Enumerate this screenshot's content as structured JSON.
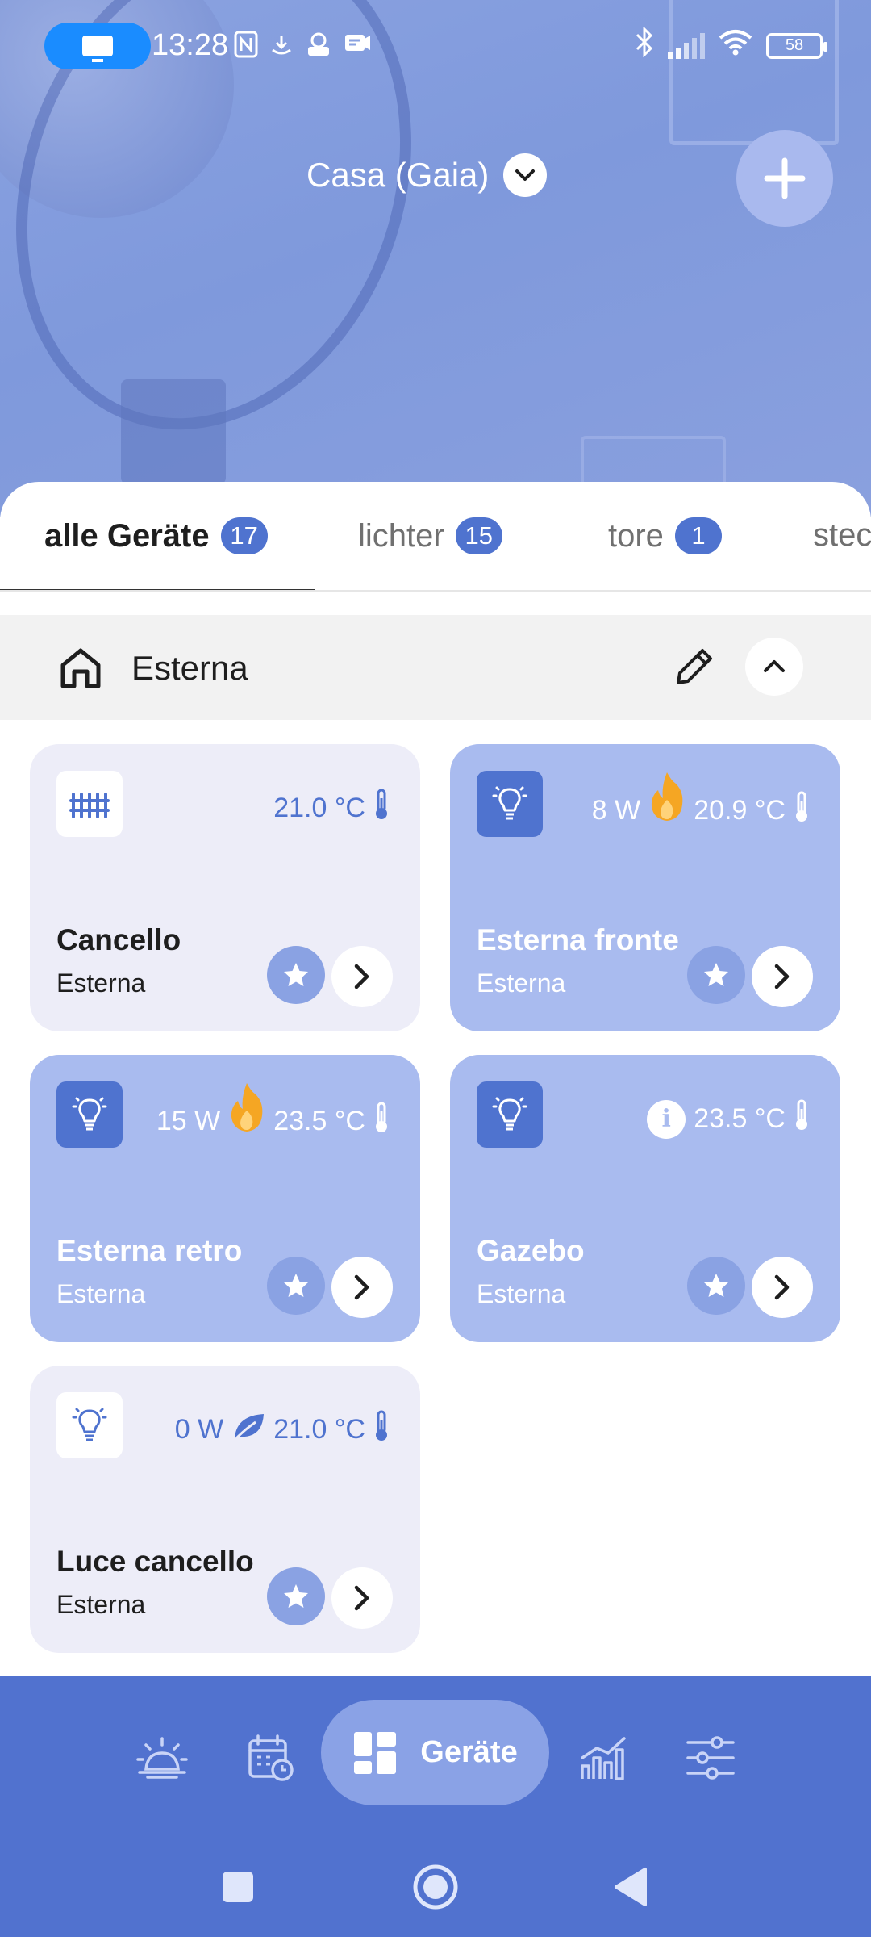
{
  "status_bar": {
    "time": "13:28",
    "battery": "58",
    "icons_left": [
      "cast-icon",
      "nfc-icon",
      "download-icon",
      "app-notification-icon",
      "message-icon"
    ],
    "icons_right": [
      "bluetooth-icon",
      "signal-icon",
      "wifi-icon",
      "battery-icon"
    ]
  },
  "header": {
    "home_name": "Casa (Gaia)",
    "selector_icon": "chevron-down-icon",
    "add_icon": "plus-icon"
  },
  "tabs": [
    {
      "label": "alle Geräte",
      "count": "17",
      "active": true
    },
    {
      "label": "lichter",
      "count": "15",
      "active": false
    },
    {
      "label": "tore",
      "count": "1",
      "active": false
    },
    {
      "label": "stec",
      "count": "",
      "active": false
    }
  ],
  "room": {
    "name": "Esterna",
    "icon": "home-icon",
    "edit_icon": "pencil-icon",
    "collapse_icon": "chevron-up-icon"
  },
  "devices": [
    {
      "name": "Cancello",
      "room": "Esterna",
      "state": "off",
      "icon": "gate-icon",
      "power": "",
      "power_icon": "",
      "temperature": "21.0 °C"
    },
    {
      "name": "Esterna fronte",
      "room": "Esterna",
      "state": "on",
      "icon": "bulb-icon",
      "power": "8 W",
      "power_icon": "fire-icon",
      "temperature": "20.9 °C"
    },
    {
      "name": "Esterna retro",
      "room": "Esterna",
      "state": "on",
      "icon": "bulb-icon",
      "power": "15 W",
      "power_icon": "fire-icon",
      "temperature": "23.5 °C"
    },
    {
      "name": "Gazebo",
      "room": "Esterna",
      "state": "on",
      "icon": "bulb-icon",
      "power": "",
      "power_icon": "info-icon",
      "temperature": "23.5 °C"
    },
    {
      "name": "Luce cancello",
      "room": "Esterna",
      "state": "off",
      "icon": "bulb-icon",
      "power": "0 W",
      "power_icon": "leaf-icon",
      "temperature": "21.0 °C"
    }
  ],
  "bottom_nav": {
    "items": [
      "sunrise-icon",
      "calendar-icon",
      "devices-icon",
      "statistics-icon",
      "settings-sliders-icon"
    ],
    "active_label": "Geräte"
  },
  "colors": {
    "primary": "#4f73cf",
    "card_on": "#a9bbef",
    "card_off": "#ededf8",
    "nav_background": "#5172cf",
    "fire": "#f5a623"
  }
}
